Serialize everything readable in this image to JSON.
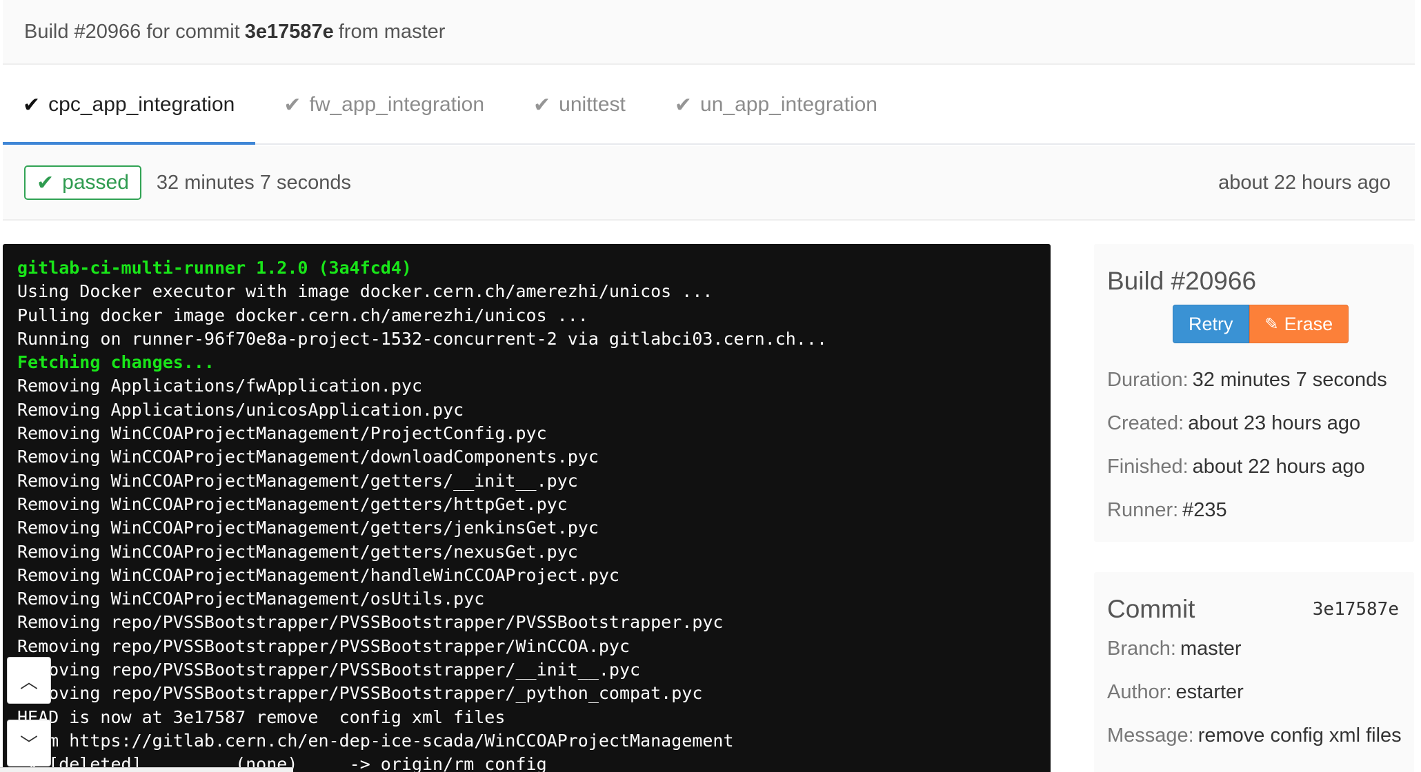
{
  "header": {
    "prefix": "Build #20966 for commit",
    "commit": "3e17587e",
    "suffix": "from master"
  },
  "tabs": [
    {
      "label": "cpc_app_integration",
      "active": true
    },
    {
      "label": "fw_app_integration",
      "active": false
    },
    {
      "label": "unittest",
      "active": false
    },
    {
      "label": "un_app_integration",
      "active": false
    }
  ],
  "status": {
    "badge": "passed",
    "duration": "32 minutes 7 seconds",
    "time_ago": "about 22 hours ago",
    "color": "#31a354"
  },
  "terminal": {
    "lines": [
      {
        "text": "gitlab-ci-multi-runner 1.2.0 (3a4fcd4)",
        "green": true
      },
      {
        "text": "Using Docker executor with image docker.cern.ch/amerezhi/unicos ...",
        "green": false
      },
      {
        "text": "Pulling docker image docker.cern.ch/amerezhi/unicos ...",
        "green": false
      },
      {
        "text": "Running on runner-96f70e8a-project-1532-concurrent-2 via gitlabci03.cern.ch...",
        "green": false
      },
      {
        "text": "Fetching changes...",
        "green": true
      },
      {
        "text": "Removing Applications/fwApplication.pyc",
        "green": false
      },
      {
        "text": "Removing Applications/unicosApplication.pyc",
        "green": false
      },
      {
        "text": "Removing WinCCOAProjectManagement/ProjectConfig.pyc",
        "green": false
      },
      {
        "text": "Removing WinCCOAProjectManagement/downloadComponents.pyc",
        "green": false
      },
      {
        "text": "Removing WinCCOAProjectManagement/getters/__init__.pyc",
        "green": false
      },
      {
        "text": "Removing WinCCOAProjectManagement/getters/httpGet.pyc",
        "green": false
      },
      {
        "text": "Removing WinCCOAProjectManagement/getters/jenkinsGet.pyc",
        "green": false
      },
      {
        "text": "Removing WinCCOAProjectManagement/getters/nexusGet.pyc",
        "green": false
      },
      {
        "text": "Removing WinCCOAProjectManagement/handleWinCCOAProject.pyc",
        "green": false
      },
      {
        "text": "Removing WinCCOAProjectManagement/osUtils.pyc",
        "green": false
      },
      {
        "text": "Removing repo/PVSSBootstrapper/PVSSBootstrapper/PVSSBootstrapper.pyc",
        "green": false
      },
      {
        "text": "Removing repo/PVSSBootstrapper/PVSSBootstrapper/WinCCOA.pyc",
        "green": false
      },
      {
        "text": "Removing repo/PVSSBootstrapper/PVSSBootstrapper/__init__.pyc",
        "green": false
      },
      {
        "text": "Removing repo/PVSSBootstrapper/PVSSBootstrapper/_python_compat.pyc",
        "green": false
      },
      {
        "text": "HEAD is now at 3e17587 remove  config xml files",
        "green": false
      },
      {
        "text": "From https://gitlab.cern.ch/en-dep-ice-scada/WinCCOAProjectManagement",
        "green": false
      },
      {
        "text": " x [deleted]         (none)     -> origin/rm_config",
        "green": false
      }
    ]
  },
  "scroll": {
    "up": "︿",
    "down": "﹀"
  },
  "sidebar": {
    "build": {
      "title": "Build #20966",
      "retry": "Retry",
      "erase": "Erase",
      "duration_label": "Duration:",
      "duration": "32 minutes 7 seconds",
      "created_label": "Created:",
      "created": "about 23 hours ago",
      "finished_label": "Finished:",
      "finished": "about 22 hours ago",
      "runner_label": "Runner:",
      "runner": "#235"
    },
    "commit": {
      "title": "Commit",
      "sha": "3e17587e",
      "branch_label": "Branch:",
      "branch": "master",
      "author_label": "Author:",
      "author": "estarter",
      "message_label": "Message:",
      "message": "remove config xml files"
    }
  },
  "colors": {
    "tab_active_underline": "#3f86d6",
    "retry": "#3a92d4",
    "erase": "#fc8039",
    "terminal_bg": "#111111",
    "terminal_green": "#19e619"
  },
  "icons": {
    "check": "check-icon",
    "eraser": "eraser-icon",
    "chevron_up": "chevron-up-icon",
    "chevron_down": "chevron-down-icon"
  }
}
